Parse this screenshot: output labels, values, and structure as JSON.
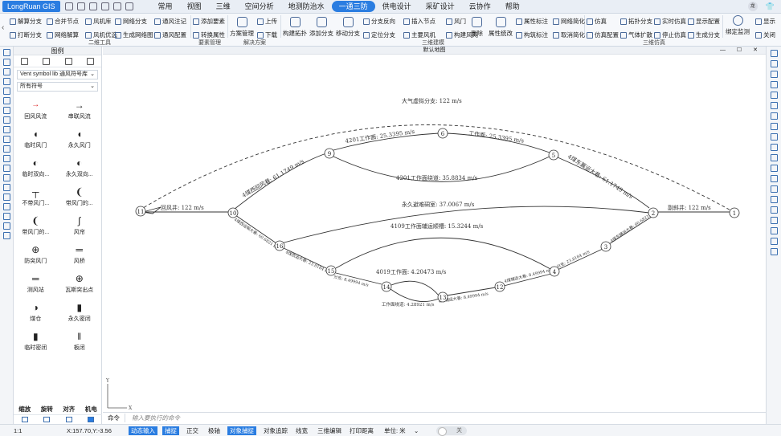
{
  "app": {
    "brand": "LongRuan GIS",
    "avatar": "龙"
  },
  "menu": [
    "常用",
    "视图",
    "三维",
    "空间分析",
    "地测防治水",
    "一通三防",
    "供电设计",
    "采矿设计",
    "云协作",
    "帮助"
  ],
  "menu_active": "一通三防",
  "ribbon": {
    "erwei": {
      "label": "二维工具",
      "r1": [
        "解算分支",
        "合并节点",
        "风机库",
        "网络分支",
        "通风注记"
      ],
      "r2": [
        "打断分支",
        "网络解算",
        "风机优选",
        "生成网络图",
        "通风配置"
      ]
    },
    "yaosu": {
      "label": "要素管理",
      "r1": "添加要素",
      "r2": "转换属性"
    },
    "jiejue": {
      "label": "解决方案",
      "b1": "方案管理",
      "b2": "上传",
      "b3": "下载"
    },
    "sanwei": {
      "label": "三维建模",
      "big": [
        "构建拓扑",
        "添加分支",
        "移动分支"
      ],
      "r1": [
        "分支反向",
        "插入节点",
        "风门"
      ],
      "r2": [
        "定位分支",
        "主要风机",
        "构建风网"
      ],
      "big2": [
        "删除",
        "属性统改"
      ],
      "r3": [
        "属性标注",
        "网络简化"
      ],
      "r4": [
        "构筑标注",
        "取消简化"
      ]
    },
    "fangzhen": {
      "label": "三维仿真",
      "r1": [
        "仿真",
        "拓扑分支",
        "实时仿真",
        "显示配置"
      ],
      "r2": [
        "仿真配置",
        "气体扩散",
        "停止仿真",
        "生成分支"
      ],
      "big": "绑定监测",
      "extra": [
        "显示",
        "关闭"
      ]
    }
  },
  "panel": {
    "title": "图例",
    "lib": "Vent symbol lib 通风符号库",
    "filter": "所有符号",
    "symbols": [
      "回风风流",
      "串联风流",
      "临时风门",
      "永久风门",
      "临时双向...",
      "永久双向...",
      "不带风门...",
      "带风门的...",
      "带风门的...",
      "风帘",
      "防突风门",
      "风桥",
      "测风站",
      "瓦斯突出点",
      "煤仓",
      "永久密闭",
      "临时密闭",
      "板闭"
    ],
    "symbol_glyphs": [
      "→",
      "→",
      "◖",
      "◖",
      "◐",
      "◐",
      "┬",
      "❨",
      "❨",
      "∫",
      "⊕",
      "═",
      "═",
      "⊕",
      "◑",
      "▮",
      "▮",
      "‖"
    ],
    "footer": [
      "缩放",
      "旋转",
      "对齐",
      "机电"
    ]
  },
  "canvas": {
    "title": "默认地图",
    "axis_x": "X",
    "axis_y": "Y"
  },
  "diagram": {
    "nodes": [
      "1",
      "2",
      "3",
      "4",
      "5",
      "6",
      "9",
      "10",
      "11",
      "12",
      "13",
      "14",
      "15",
      "16"
    ],
    "labels": {
      "top_arc": "大气虚拟分支: 122 m/s",
      "node_6_5": "工作面: 25.3395 m/s",
      "node_9_6": "4201工作面: 25.3395 m/s",
      "node_5_9": "4201工作面绕道: 35.8834 m/s",
      "node_5_2": "4煤东翼运大巷: 61.1749 m/s",
      "node_10_9": "4煤西回风巷: 61.1749 m/s",
      "node_11_10": "回风井: 122 m/s",
      "node_2_1": "副斜井: 122 m/s",
      "mid_arc": "永久避难硐室: 37.0067 m/s",
      "inner_arc": "4109工作面辅运顺槽: 15.3244 m/s",
      "small_loop_top": "4019工作面: 4.20473 m/s",
      "small_loop_bot": "工作面绕道: 4.28921 m/s",
      "r_2_3": "4煤东辅运大巷: 60.6821 m/s",
      "r_3_4": "分支: 23.8184 m/s",
      "r_4_12": "4煤辅运大巷: 8.49994 m/s",
      "r_12_13": "4煤辅运大巷: 8.49994 m/s",
      "l_10_16": "4煤西运输大巷: 60.6821 m/s",
      "l_16_15": "4煤西运大巷: 23.8184 m/s",
      "l_15_14": "分支: 8.49994 m/s"
    }
  },
  "command": {
    "label": "命令",
    "placeholder": "输入要执行的命令"
  },
  "status": {
    "scale": "1:1",
    "coords": "X:157.70,Y:-3.56",
    "modes": [
      "动态输入",
      "捕捉",
      "正交",
      "极轴",
      "对象捕捉",
      "对象追踪",
      "线宽",
      "三维编辑",
      "打印距离"
    ],
    "modes_on": [
      "动态输入",
      "捕捉",
      "对象捕捉"
    ],
    "unit": "单位: 米",
    "toggle": "关"
  }
}
